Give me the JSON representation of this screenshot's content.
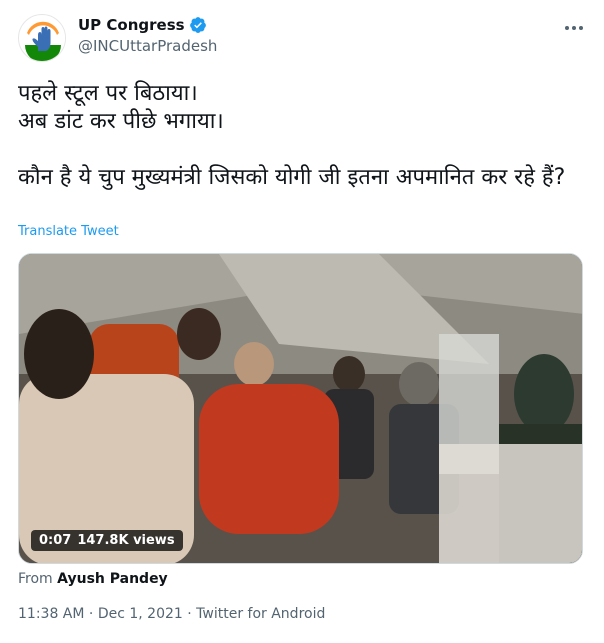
{
  "author": {
    "name": "UP Congress",
    "handle": "@INCUttarPradesh",
    "verified": true
  },
  "tweet": {
    "lines": [
      "पहले स्टूल पर बिठाया।",
      "अब डांट कर पीछे भगाया।"
    ],
    "line3": "कौन है ये चुप मुख्यमंत्री जिसको योगी जी इतना अपमानित कर रहे हैं?",
    "translate_label": "Translate Tweet"
  },
  "media": {
    "duration": "0:07",
    "views": "147.8K views"
  },
  "from": {
    "prefix": "From",
    "name": "Ayush Pandey"
  },
  "meta": {
    "time": "11:38 AM",
    "sep1": "·",
    "date": "Dec 1, 2021",
    "sep2": "·",
    "source": "Twitter for Android"
  },
  "colors": {
    "link": "#1d9bf0",
    "secondary": "#536471",
    "text": "#0f1419"
  }
}
